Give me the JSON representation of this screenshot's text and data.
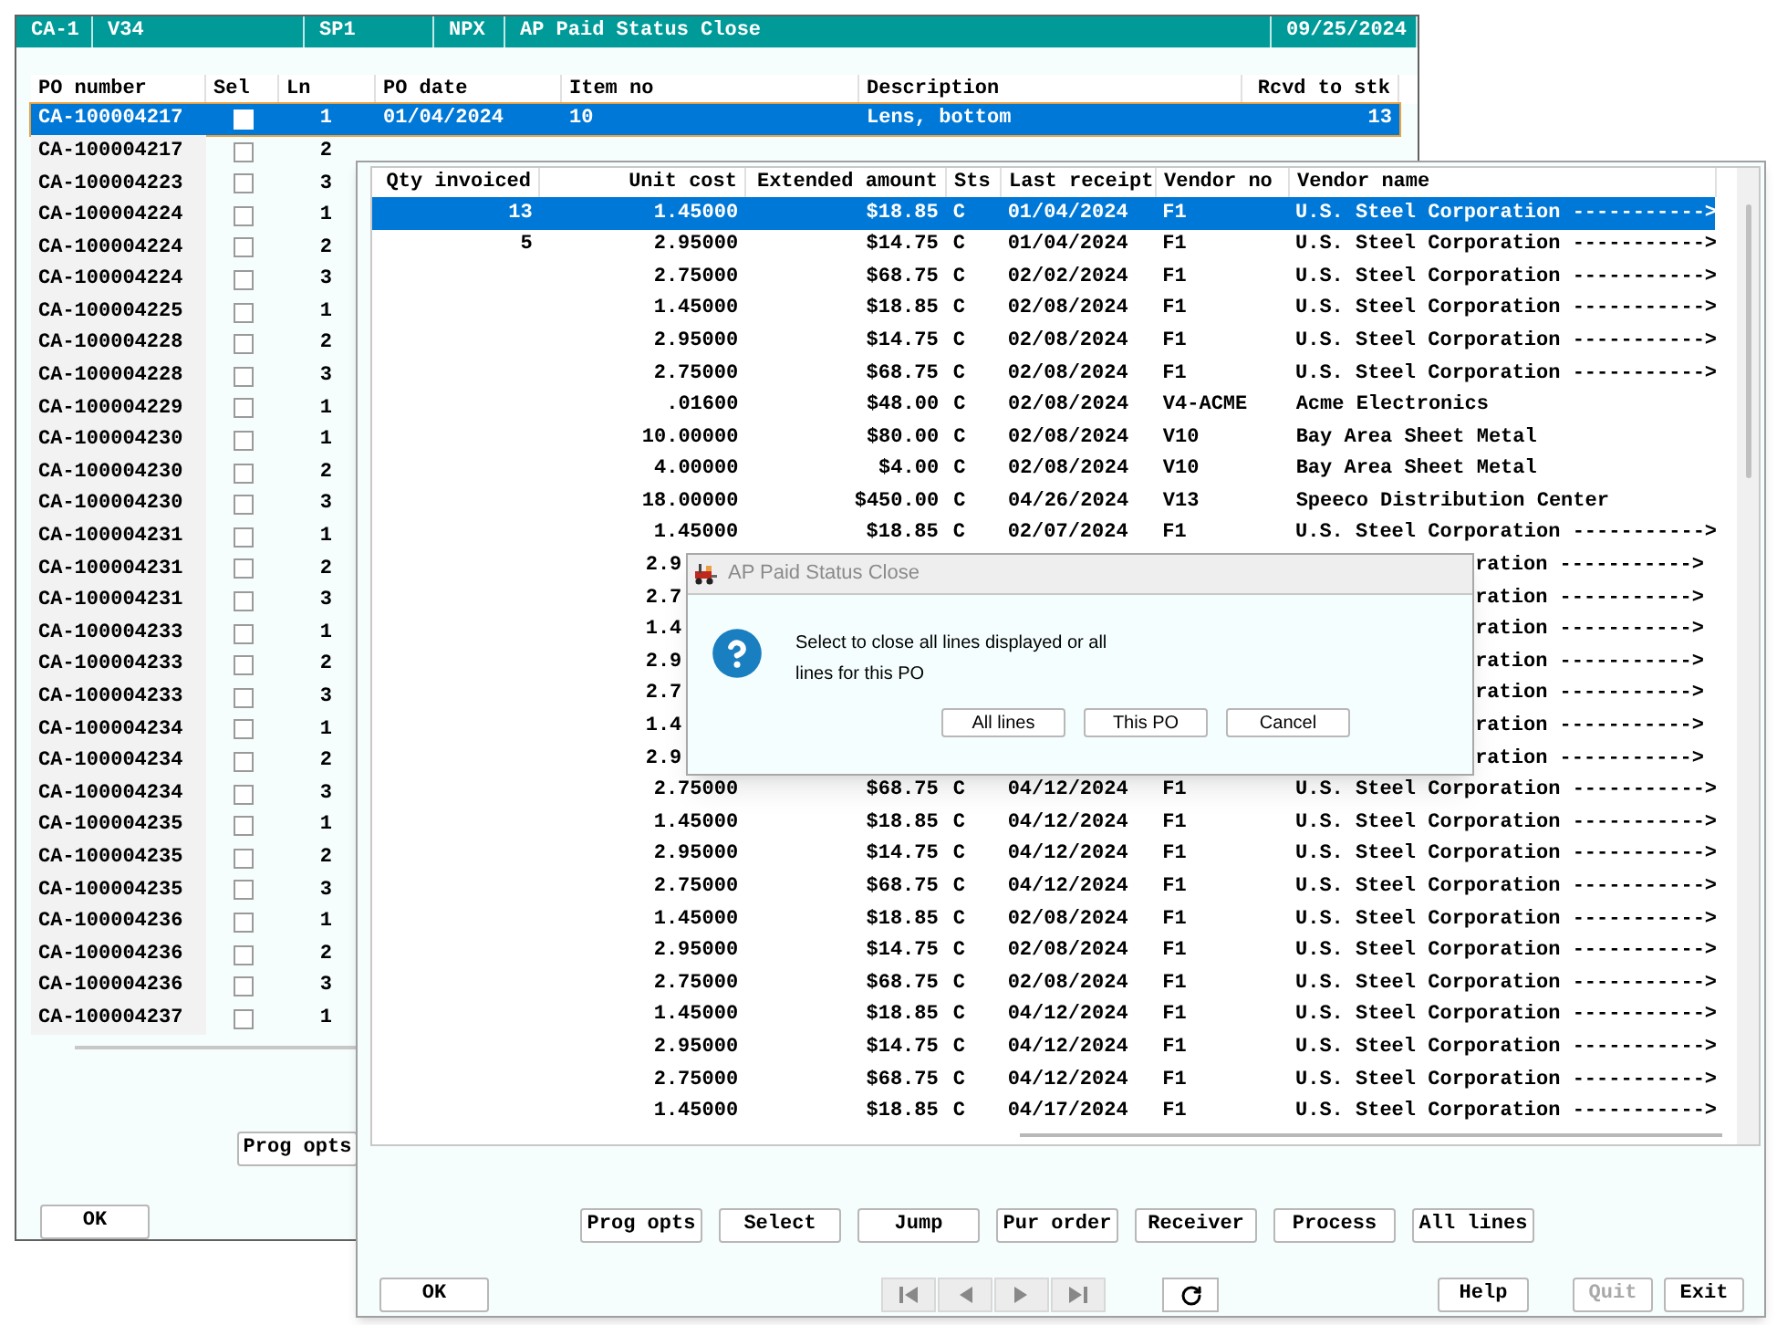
{
  "back_window": {
    "title_bar": [
      {
        "text": "CA-1"
      },
      {
        "text": "V34"
      },
      {
        "text": "SP1"
      },
      {
        "text": "NPX"
      },
      {
        "text": "AP Paid Status Close"
      },
      {
        "text": "09/25/2024"
      }
    ],
    "table": {
      "columns": [
        "PO number",
        "Sel",
        "Ln",
        "PO date",
        "Item no",
        "Description",
        "Rcvd to stk"
      ],
      "rows": [
        {
          "po_number": "CA-100004217",
          "checked": false,
          "ln": "1",
          "po_date": "01/04/2024",
          "item_no": "10",
          "description": "Lens, bottom",
          "rcvd_to_stk": "13",
          "selected": true
        },
        {
          "po_number": "CA-100004217",
          "checked": false,
          "ln": "2",
          "selected": false
        },
        {
          "po_number": "CA-100004223",
          "checked": false,
          "ln": "3",
          "selected": false
        },
        {
          "po_number": "CA-100004224",
          "checked": false,
          "ln": "1",
          "selected": false
        },
        {
          "po_number": "CA-100004224",
          "checked": false,
          "ln": "2",
          "selected": false
        },
        {
          "po_number": "CA-100004224",
          "checked": false,
          "ln": "3",
          "selected": false
        },
        {
          "po_number": "CA-100004225",
          "checked": false,
          "ln": "1",
          "selected": false
        },
        {
          "po_number": "CA-100004228",
          "checked": false,
          "ln": "2",
          "selected": false
        },
        {
          "po_number": "CA-100004228",
          "checked": false,
          "ln": "3",
          "selected": false
        },
        {
          "po_number": "CA-100004229",
          "checked": false,
          "ln": "1",
          "selected": false
        },
        {
          "po_number": "CA-100004230",
          "checked": false,
          "ln": "1",
          "selected": false
        },
        {
          "po_number": "CA-100004230",
          "checked": false,
          "ln": "2",
          "selected": false
        },
        {
          "po_number": "CA-100004230",
          "checked": false,
          "ln": "3",
          "selected": false
        },
        {
          "po_number": "CA-100004231",
          "checked": false,
          "ln": "1",
          "selected": false
        },
        {
          "po_number": "CA-100004231",
          "checked": false,
          "ln": "2",
          "selected": false
        },
        {
          "po_number": "CA-100004231",
          "checked": false,
          "ln": "3",
          "selected": false
        },
        {
          "po_number": "CA-100004233",
          "checked": false,
          "ln": "1",
          "selected": false
        },
        {
          "po_number": "CA-100004233",
          "checked": false,
          "ln": "2",
          "selected": false
        },
        {
          "po_number": "CA-100004233",
          "checked": false,
          "ln": "3",
          "selected": false
        },
        {
          "po_number": "CA-100004234",
          "checked": false,
          "ln": "1",
          "selected": false
        },
        {
          "po_number": "CA-100004234",
          "checked": false,
          "ln": "2",
          "selected": false
        },
        {
          "po_number": "CA-100004234",
          "checked": false,
          "ln": "3",
          "selected": false
        },
        {
          "po_number": "CA-100004235",
          "checked": false,
          "ln": "1",
          "selected": false
        },
        {
          "po_number": "CA-100004235",
          "checked": false,
          "ln": "2",
          "selected": false
        },
        {
          "po_number": "CA-100004235",
          "checked": false,
          "ln": "3",
          "selected": false
        },
        {
          "po_number": "CA-100004236",
          "checked": false,
          "ln": "1",
          "selected": false
        },
        {
          "po_number": "CA-100004236",
          "checked": false,
          "ln": "2",
          "selected": false
        },
        {
          "po_number": "CA-100004236",
          "checked": false,
          "ln": "3",
          "selected": false
        },
        {
          "po_number": "CA-100004237",
          "checked": false,
          "ln": "1",
          "selected": false
        }
      ]
    },
    "prog_opts_button": "Prog opts",
    "ok_button": "OK"
  },
  "front_window": {
    "table": {
      "columns": [
        "Qty invoiced",
        "Unit cost",
        "Extended amount",
        "Sts",
        "Last receipt",
        "Vendor no",
        "Vendor name"
      ],
      "rows": [
        {
          "kind": "full",
          "selected": true,
          "qty_invoiced": "13",
          "unit_cost": "1.45000",
          "extended_amount": "$18.85",
          "sts": "C",
          "last_receipt": "01/04/2024",
          "vendor_no": "F1",
          "vendor_name": "U.S. Steel Corporation ----------->"
        },
        {
          "kind": "full",
          "selected": false,
          "qty_invoiced": "5",
          "unit_cost": "2.95000",
          "extended_amount": "$14.75",
          "sts": "C",
          "last_receipt": "01/04/2024",
          "vendor_no": "F1",
          "vendor_name": "U.S. Steel Corporation ----------->"
        },
        {
          "kind": "full",
          "selected": false,
          "unit_cost": "2.75000",
          "extended_amount": "$68.75",
          "sts": "C",
          "last_receipt": "02/02/2024",
          "vendor_no": "F1",
          "vendor_name": "U.S. Steel Corporation ----------->"
        },
        {
          "kind": "full",
          "selected": false,
          "unit_cost": "1.45000",
          "extended_amount": "$18.85",
          "sts": "C",
          "last_receipt": "02/08/2024",
          "vendor_no": "F1",
          "vendor_name": "U.S. Steel Corporation ----------->"
        },
        {
          "kind": "full",
          "selected": false,
          "unit_cost": "2.95000",
          "extended_amount": "$14.75",
          "sts": "C",
          "last_receipt": "02/08/2024",
          "vendor_no": "F1",
          "vendor_name": "U.S. Steel Corporation ----------->"
        },
        {
          "kind": "full",
          "selected": false,
          "unit_cost": "2.75000",
          "extended_amount": "$68.75",
          "sts": "C",
          "last_receipt": "02/08/2024",
          "vendor_no": "F1",
          "vendor_name": "U.S. Steel Corporation ----------->"
        },
        {
          "kind": "full",
          "selected": false,
          "unit_cost": ".01600",
          "extended_amount": "$48.00",
          "sts": "C",
          "last_receipt": "02/08/2024",
          "vendor_no": "V4-ACME",
          "vendor_name": "Acme Electronics"
        },
        {
          "kind": "full",
          "selected": false,
          "unit_cost": "10.00000",
          "extended_amount": "$80.00",
          "sts": "C",
          "last_receipt": "02/08/2024",
          "vendor_no": "V10",
          "vendor_name": "Bay Area Sheet Metal"
        },
        {
          "kind": "full",
          "selected": false,
          "unit_cost": "4.00000",
          "extended_amount": "$4.00",
          "sts": "C",
          "last_receipt": "02/08/2024",
          "vendor_no": "V10",
          "vendor_name": "Bay Area Sheet Metal"
        },
        {
          "kind": "full",
          "selected": false,
          "unit_cost": "18.00000",
          "extended_amount": "$450.00",
          "sts": "C",
          "last_receipt": "04/26/2024",
          "vendor_no": "V13",
          "vendor_name": "Speeco Distribution Center"
        },
        {
          "kind": "full",
          "selected": false,
          "unit_cost": "1.45000",
          "extended_amount": "$18.85",
          "sts": "C",
          "last_receipt": "02/07/2024",
          "vendor_no": "F1",
          "vendor_name": "U.S. Steel Corporation ----------->"
        },
        {
          "kind": "covered",
          "selected": false,
          "unit_cost": "2.9",
          "vendor_name": "ration ----------->"
        },
        {
          "kind": "covered",
          "selected": false,
          "unit_cost": "2.7",
          "vendor_name": "ration ----------->"
        },
        {
          "kind": "covered",
          "selected": false,
          "unit_cost": "1.4",
          "vendor_name": "ration ----------->"
        },
        {
          "kind": "covered",
          "selected": false,
          "unit_cost": "2.9",
          "vendor_name": "ration ----------->"
        },
        {
          "kind": "covered",
          "selected": false,
          "unit_cost": "2.7",
          "vendor_name": "ration ----------->"
        },
        {
          "kind": "covered",
          "selected": false,
          "unit_cost": "1.4",
          "vendor_name": "ration ----------->"
        },
        {
          "kind": "covered",
          "selected": false,
          "unit_cost": "2.9",
          "vendor_name": "ration ----------->"
        },
        {
          "kind": "full",
          "selected": false,
          "unit_cost": "2.75000",
          "extended_amount": "$68.75",
          "sts": "C",
          "last_receipt": "04/12/2024",
          "vendor_no": "F1",
          "vendor_name": "U.S. Steel Corporation ----------->"
        },
        {
          "kind": "full",
          "selected": false,
          "unit_cost": "1.45000",
          "extended_amount": "$18.85",
          "sts": "C",
          "last_receipt": "04/12/2024",
          "vendor_no": "F1",
          "vendor_name": "U.S. Steel Corporation ----------->"
        },
        {
          "kind": "full",
          "selected": false,
          "unit_cost": "2.95000",
          "extended_amount": "$14.75",
          "sts": "C",
          "last_receipt": "04/12/2024",
          "vendor_no": "F1",
          "vendor_name": "U.S. Steel Corporation ----------->"
        },
        {
          "kind": "full",
          "selected": false,
          "unit_cost": "2.75000",
          "extended_amount": "$68.75",
          "sts": "C",
          "last_receipt": "04/12/2024",
          "vendor_no": "F1",
          "vendor_name": "U.S. Steel Corporation ----------->"
        },
        {
          "kind": "full",
          "selected": false,
          "unit_cost": "1.45000",
          "extended_amount": "$18.85",
          "sts": "C",
          "last_receipt": "02/08/2024",
          "vendor_no": "F1",
          "vendor_name": "U.S. Steel Corporation ----------->"
        },
        {
          "kind": "full",
          "selected": false,
          "unit_cost": "2.95000",
          "extended_amount": "$14.75",
          "sts": "C",
          "last_receipt": "02/08/2024",
          "vendor_no": "F1",
          "vendor_name": "U.S. Steel Corporation ----------->"
        },
        {
          "kind": "full",
          "selected": false,
          "unit_cost": "2.75000",
          "extended_amount": "$68.75",
          "sts": "C",
          "last_receipt": "02/08/2024",
          "vendor_no": "F1",
          "vendor_name": "U.S. Steel Corporation ----------->"
        },
        {
          "kind": "full",
          "selected": false,
          "unit_cost": "1.45000",
          "extended_amount": "$18.85",
          "sts": "C",
          "last_receipt": "04/12/2024",
          "vendor_no": "F1",
          "vendor_name": "U.S. Steel Corporation ----------->"
        },
        {
          "kind": "full",
          "selected": false,
          "unit_cost": "2.95000",
          "extended_amount": "$14.75",
          "sts": "C",
          "last_receipt": "04/12/2024",
          "vendor_no": "F1",
          "vendor_name": "U.S. Steel Corporation ----------->"
        },
        {
          "kind": "full",
          "selected": false,
          "unit_cost": "2.75000",
          "extended_amount": "$68.75",
          "sts": "C",
          "last_receipt": "04/12/2024",
          "vendor_no": "F1",
          "vendor_name": "U.S. Steel Corporation ----------->"
        },
        {
          "kind": "full",
          "selected": false,
          "unit_cost": "1.45000",
          "extended_amount": "$18.85",
          "sts": "C",
          "last_receipt": "04/17/2024",
          "vendor_no": "F1",
          "vendor_name": "U.S. Steel Corporation ----------->"
        }
      ]
    },
    "action_buttons": [
      {
        "label": "Prog opts"
      },
      {
        "label": "Select"
      },
      {
        "label": "Jump"
      },
      {
        "label": "Pur order"
      },
      {
        "label": "Receiver"
      },
      {
        "label": "Process"
      },
      {
        "label": "All lines"
      }
    ],
    "ok_button": "OK",
    "right_buttons": [
      {
        "label": "Help",
        "disabled": false
      },
      {
        "label": "Quit",
        "disabled": true
      },
      {
        "label": "Exit",
        "disabled": false
      }
    ]
  },
  "dialog": {
    "title": "AP Paid Status Close",
    "message": "Select to close all lines displayed or all lines for this PO",
    "buttons": [
      {
        "label": "All lines"
      },
      {
        "label": "This PO"
      },
      {
        "label": "Cancel"
      }
    ]
  }
}
